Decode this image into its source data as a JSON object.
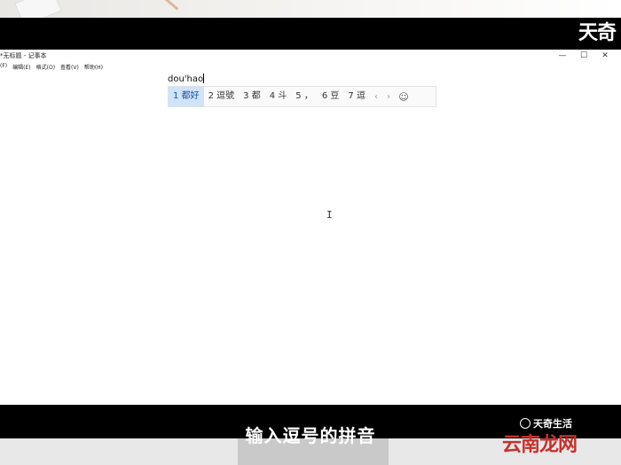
{
  "window": {
    "title": "*无标题 - 记事本",
    "controls": [
      "—",
      "☐",
      "✕"
    ]
  },
  "menu": [
    "(F)",
    "编辑(E)",
    "格式(O)",
    "查看(V)",
    "帮助(H)"
  ],
  "ime": {
    "composition": "dou'hao",
    "candidates": [
      {
        "index": "1",
        "text": "都好"
      },
      {
        "index": "2",
        "text": "逗號"
      },
      {
        "index": "3",
        "text": "都"
      },
      {
        "index": "4",
        "text": "斗"
      },
      {
        "index": "5",
        "text": "，"
      },
      {
        "index": "6",
        "text": "豆"
      },
      {
        "index": "7",
        "text": "逗"
      }
    ],
    "prev": "‹",
    "next": "›",
    "emoji": "☺"
  },
  "cursor_glyph": "I",
  "subtitle": "输入逗号的拼音",
  "watermark": {
    "top": "天奇",
    "brand_small": "天奇生活",
    "brand_large": "云南龙网"
  },
  "colors": {
    "selected_candidate_bg": "#cfe3fb",
    "brand_red": "#c9302c"
  }
}
